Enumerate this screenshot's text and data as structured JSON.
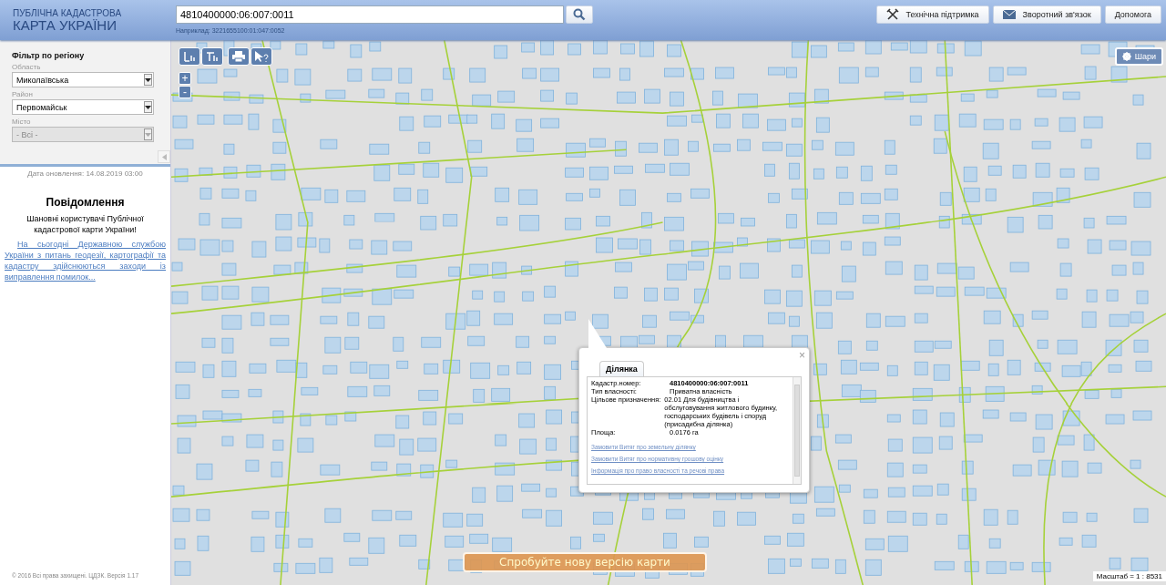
{
  "header": {
    "logo_line1": "ПУБЛІЧНА КАДАСТРОВА",
    "logo_line2": "КАРТА УКРАЇНИ",
    "search": {
      "value": "4810400000:06:007:0011",
      "hint": "Наприклад: 3221655100:01:047:0052"
    },
    "buttons": [
      {
        "label": "Технічна підтримка",
        "kind": "tools"
      },
      {
        "label": "Зворотний зв'язок",
        "kind": "mail"
      },
      {
        "label": "Допомога",
        "kind": "plain"
      }
    ]
  },
  "sidebar": {
    "filter": {
      "title": "Фільтр по регіону",
      "fields": [
        {
          "label": "Область",
          "value": "Миколаївська",
          "disabled": false
        },
        {
          "label": "Район",
          "value": "Первомайськ",
          "disabled": false
        },
        {
          "label": "Місто",
          "value": "- Всі -",
          "disabled": true
        }
      ]
    },
    "update_date": "Дата оновлення: 14.08.2019 03:00",
    "notice": {
      "title": "Повідомлення",
      "greeting": "Шановні користувачі Публічної кадастрової карти України!",
      "link": "На сьогодні Державною службою України з питань геодезії, картографії та кадастру здійснюються заходи із виправлення помилок..."
    },
    "footer": "© 2016 Всі права захищені. ЦДЗК. Версія 1.17"
  },
  "map": {
    "zoom": [
      "+",
      "-"
    ],
    "layers_button": "Шари",
    "popup": {
      "tab": "Ділянка",
      "close": "×",
      "rows": [
        {
          "label": "Кадастр.номер:",
          "value": "4810400000:06:007:0011",
          "emphasis": true
        },
        {
          "label": "Тип власності:",
          "value": "Приватна власність",
          "emphasis": false
        },
        {
          "label": "Цільове призначення:",
          "value": "02.01 Для будівництва і обслуговування житлового будинку, господарських будівель і споруд (присадибна ділянка)",
          "emphasis": false
        },
        {
          "label": "Площа:",
          "value": "0.0176 га",
          "emphasis": false
        }
      ],
      "links": [
        "Замовити Витяг про земельну ділянку",
        "Замовити Витяг про нормативну грошову оцінку",
        "Інформація про право власності та речові права"
      ]
    },
    "promo": "Спробуйте нову версію карти",
    "scale": "Масштаб = 1 : 8531"
  }
}
